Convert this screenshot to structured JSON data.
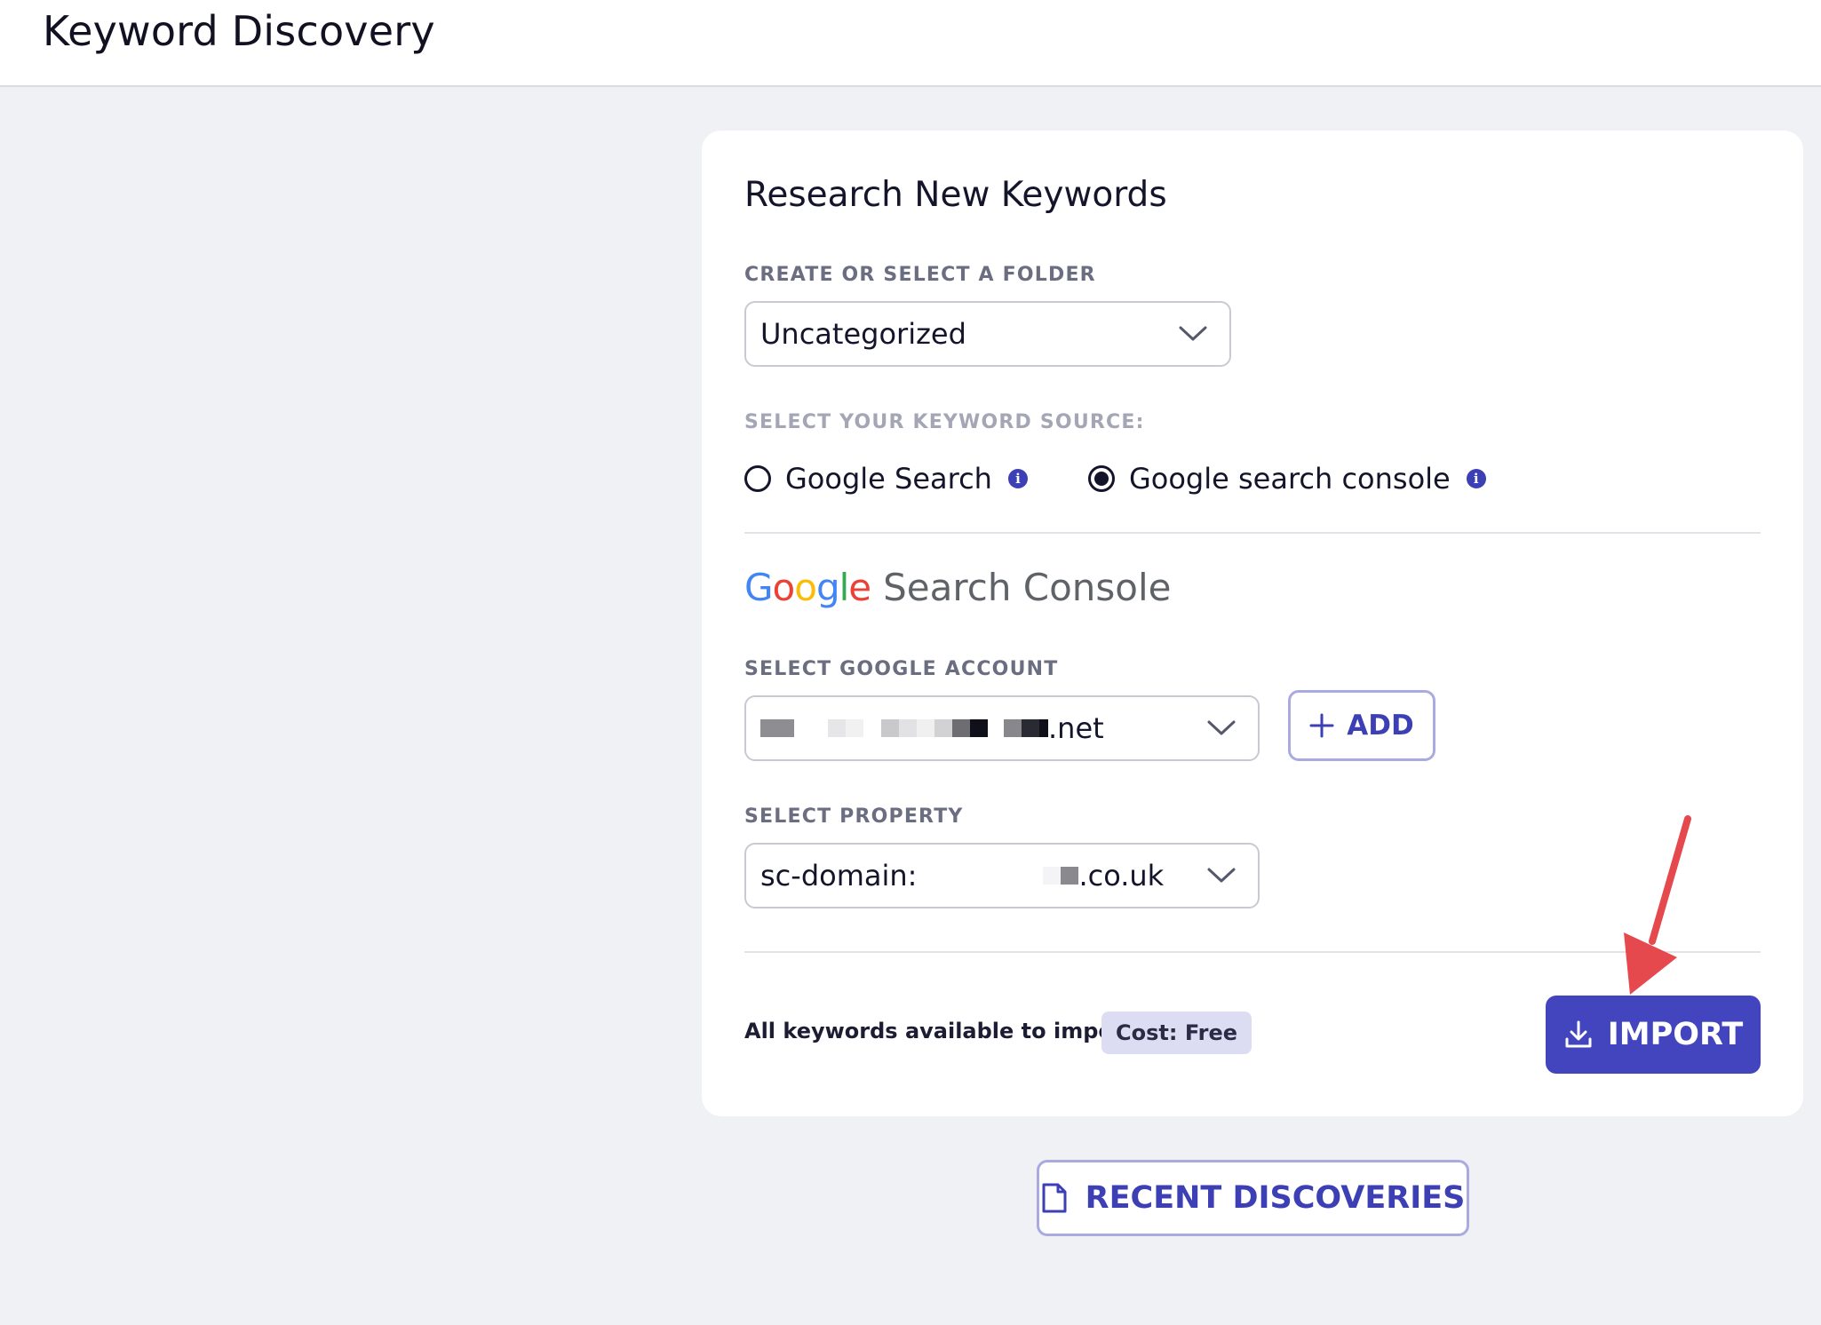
{
  "header": {
    "title": "Keyword Discovery"
  },
  "card": {
    "title": "Research New Keywords",
    "folder": {
      "label": "CREATE OR SELECT A FOLDER",
      "value": "Uncategorized"
    },
    "source": {
      "label": "SELECT YOUR KEYWORD SOURCE:",
      "options": [
        {
          "label": "Google Search",
          "selected": false
        },
        {
          "label": "Google search console",
          "selected": true
        }
      ]
    },
    "gsc": {
      "logo_letters": [
        "G",
        "o",
        "o",
        "g",
        "l",
        "e"
      ],
      "logo_colors": [
        "#4285F4",
        "#EA4335",
        "#FBBC05",
        "#4285F4",
        "#34A853",
        "#EA4335"
      ],
      "logo_rest": "Search Console"
    },
    "account": {
      "label": "SELECT GOOGLE ACCOUNT",
      "value_suffix": ".net",
      "add_label": "ADD"
    },
    "property": {
      "label": "SELECT PROPERTY",
      "value_prefix": "sc-domain:",
      "value_suffix": ".co.uk"
    },
    "footer": {
      "available_text": "All keywords available to import",
      "cost_badge": "Cost: Free",
      "import_label": "IMPORT"
    }
  },
  "recent": {
    "label": "RECENT DISCOVERIES"
  },
  "colors": {
    "accent": "#4245be",
    "annotation_arrow": "#e5484d"
  }
}
